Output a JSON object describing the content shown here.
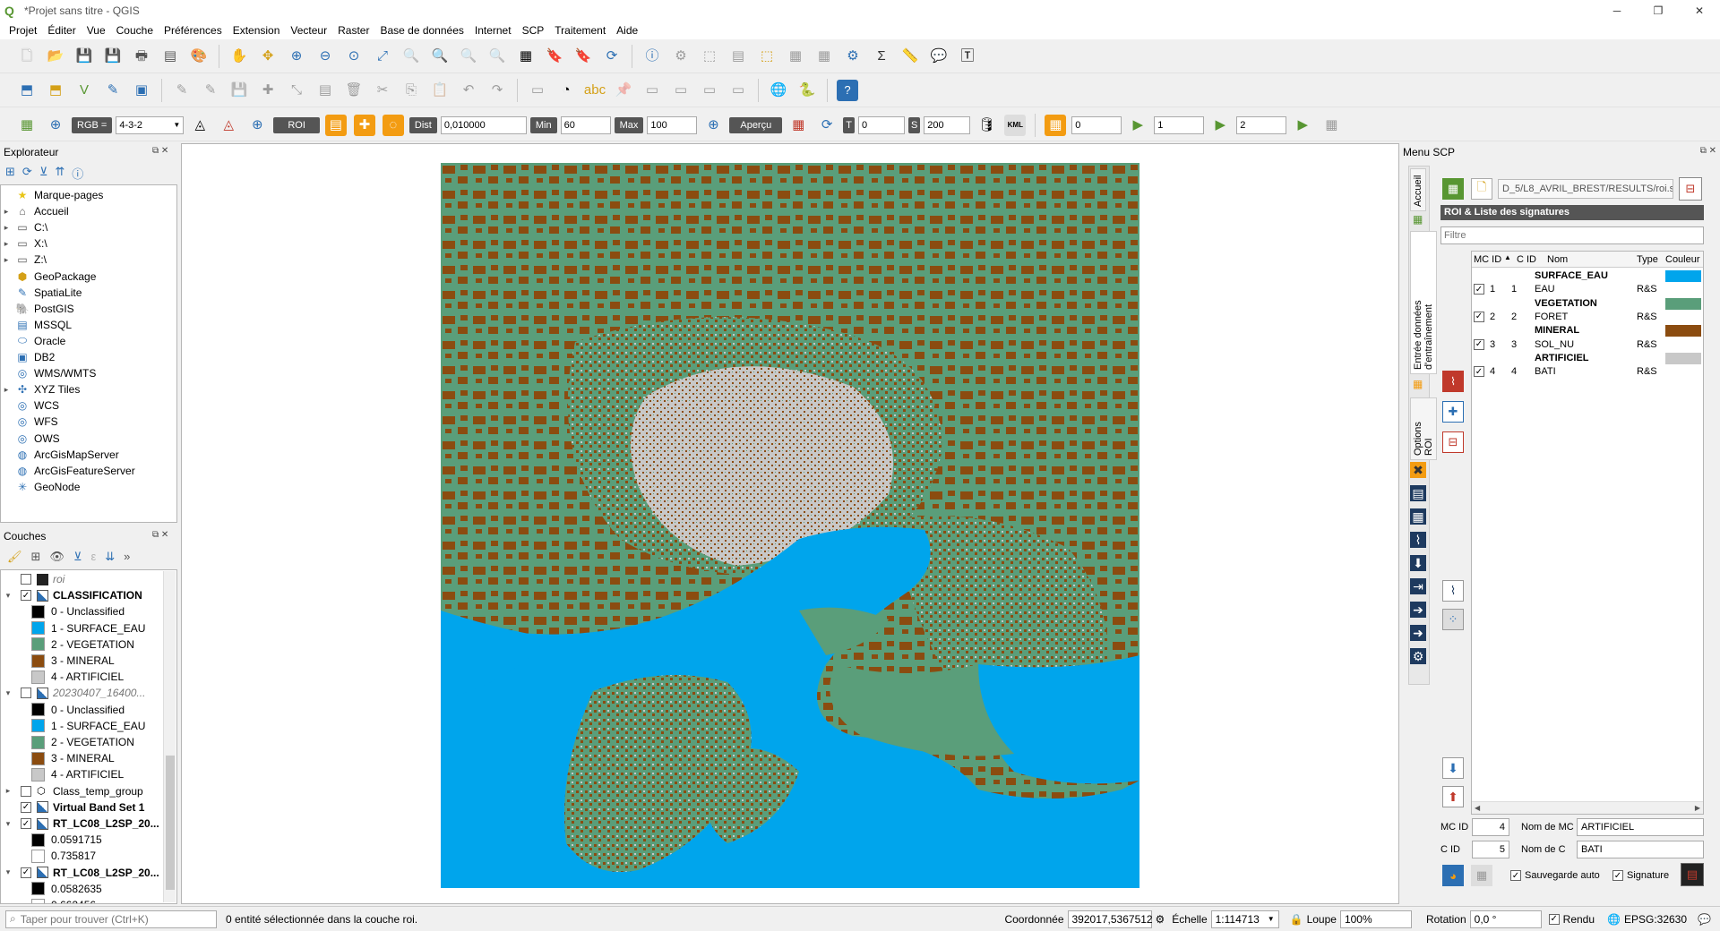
{
  "window": {
    "title": "*Projet sans titre - QGIS"
  },
  "menubar": {
    "items": [
      "Projet",
      "Éditer",
      "Vue",
      "Couche",
      "Préférences",
      "Extension",
      "Vecteur",
      "Raster",
      "Base de données",
      "Internet",
      "SCP",
      "Traitement",
      "Aide"
    ]
  },
  "scp_toolbar": {
    "rgb_label": "RGB =",
    "rgb_value": "4-3-2",
    "roi_label": "ROI",
    "dist_label": "Dist",
    "dist_value": "0,010000",
    "min_label": "Min",
    "min_value": "60",
    "max_label": "Max",
    "max_value": "100",
    "apercu_label": "Aperçu",
    "t_label": "T",
    "t_value": "0",
    "s_label": "S",
    "s_value": "200",
    "kml_label": "KML",
    "field1_value": "0",
    "field2_value": "1",
    "field3_value": "2"
  },
  "explorer": {
    "title": "Explorateur",
    "items": [
      {
        "label": "Marque-pages",
        "icon": "star-icon",
        "expandable": false
      },
      {
        "label": "Accueil",
        "icon": "folder-home-icon",
        "expandable": true
      },
      {
        "label": "C:\\",
        "icon": "folder-icon",
        "expandable": true
      },
      {
        "label": "X:\\",
        "icon": "folder-icon",
        "expandable": true
      },
      {
        "label": "Z:\\",
        "icon": "folder-icon",
        "expandable": true
      },
      {
        "label": "GeoPackage",
        "icon": "geopackage-icon",
        "expandable": false
      },
      {
        "label": "SpatiaLite",
        "icon": "spatialite-icon",
        "expandable": false
      },
      {
        "label": "PostGIS",
        "icon": "postgis-icon",
        "expandable": false
      },
      {
        "label": "MSSQL",
        "icon": "mssql-icon",
        "expandable": false
      },
      {
        "label": "Oracle",
        "icon": "oracle-icon",
        "expandable": false
      },
      {
        "label": "DB2",
        "icon": "db2-icon",
        "expandable": false
      },
      {
        "label": "WMS/WMTS",
        "icon": "wms-icon",
        "expandable": false
      },
      {
        "label": "XYZ Tiles",
        "icon": "xyz-icon",
        "expandable": true
      },
      {
        "label": "WCS",
        "icon": "wcs-icon",
        "expandable": false
      },
      {
        "label": "WFS",
        "icon": "wfs-icon",
        "expandable": false
      },
      {
        "label": "OWS",
        "icon": "ows-icon",
        "expandable": false
      },
      {
        "label": "ArcGisMapServer",
        "icon": "arcgis-icon",
        "expandable": false
      },
      {
        "label": "ArcGisFeatureServer",
        "icon": "arcgis-icon",
        "expandable": false
      },
      {
        "label": "GeoNode",
        "icon": "geonode-icon",
        "expandable": false
      }
    ]
  },
  "layers": {
    "title": "Couches",
    "items": [
      {
        "label": "roi",
        "type": "layer",
        "checked": false,
        "italic": true,
        "bold": false,
        "indent": 0,
        "icon_color": "#222222"
      },
      {
        "label": "CLASSIFICATION",
        "type": "layer",
        "checked": true,
        "italic": false,
        "bold": true,
        "indent": 0,
        "expanded": true,
        "icon_color": "raster"
      },
      {
        "label": "0 - Unclassified",
        "type": "legend",
        "color": "#000000",
        "indent": 1
      },
      {
        "label": "1 - SURFACE_EAU",
        "type": "legend",
        "color": "#00a5ec",
        "indent": 1
      },
      {
        "label": "2 - VEGETATION",
        "type": "legend",
        "color": "#5a9e7a",
        "indent": 1
      },
      {
        "label": "3 - MINERAL",
        "type": "legend",
        "color": "#8b4c10",
        "indent": 1
      },
      {
        "label": "4 - ARTIFICIEL",
        "type": "legend",
        "color": "#c8c8c8",
        "indent": 1
      },
      {
        "label": "20230407_16400...",
        "type": "layer",
        "checked": false,
        "italic": true,
        "bold": false,
        "indent": 0,
        "expanded": true,
        "icon_color": "raster"
      },
      {
        "label": "0 - Unclassified",
        "type": "legend",
        "color": "#000000",
        "indent": 1
      },
      {
        "label": "1 - SURFACE_EAU",
        "type": "legend",
        "color": "#00a5ec",
        "indent": 1
      },
      {
        "label": "2 - VEGETATION",
        "type": "legend",
        "color": "#5a9e7a",
        "indent": 1
      },
      {
        "label": "3 - MINERAL",
        "type": "legend",
        "color": "#8b4c10",
        "indent": 1
      },
      {
        "label": "4 - ARTIFICIEL",
        "type": "legend",
        "color": "#c8c8c8",
        "indent": 1
      },
      {
        "label": "Class_temp_group",
        "type": "group",
        "checked": false,
        "italic": false,
        "bold": false,
        "indent": 0
      },
      {
        "label": "Virtual Band Set 1",
        "type": "layer",
        "checked": true,
        "italic": false,
        "bold": true,
        "indent": 0,
        "icon_color": "raster"
      },
      {
        "label": "RT_LC08_L2SP_20...",
        "type": "layer",
        "checked": true,
        "italic": false,
        "bold": true,
        "indent": 0,
        "expanded": true,
        "icon_color": "raster"
      },
      {
        "label": "0.0591715",
        "type": "legend",
        "color": "#000000",
        "indent": 1
      },
      {
        "label": "0.735817",
        "type": "legend",
        "color": "#ffffff",
        "indent": 1
      },
      {
        "label": "RT_LC08_L2SP_20...",
        "type": "layer",
        "checked": true,
        "italic": false,
        "bold": true,
        "indent": 0,
        "expanded": true,
        "icon_color": "raster"
      },
      {
        "label": "0.0582635",
        "type": "legend",
        "color": "#000000",
        "indent": 1
      },
      {
        "label": "0.662456",
        "type": "legend",
        "color": "#ffffff",
        "indent": 1
      }
    ]
  },
  "scp_menu": {
    "title": "Menu SCP",
    "tabs": [
      "Accueil",
      "Entrée données d'entraînement",
      "Options ROI"
    ],
    "file_path": "D_5/L8_AVRIL_BREST/RESULTS/roi.scp",
    "section_title": "ROI & Liste des signatures",
    "filter_placeholder": "Filtre",
    "columns": [
      "MC ID",
      "C ID",
      "Nom",
      "Type",
      "Couleur"
    ],
    "rows": [
      {
        "mc_id": "",
        "c_id": "",
        "name": "SURFACE_EAU",
        "type": "",
        "color": "#00a5ec",
        "is_class": true,
        "checked": false
      },
      {
        "mc_id": "1",
        "c_id": "1",
        "name": "EAU",
        "type": "R&S",
        "color": "",
        "is_class": false,
        "checked": true
      },
      {
        "mc_id": "",
        "c_id": "",
        "name": "VEGETATION",
        "type": "",
        "color": "#5a9e7a",
        "is_class": true,
        "checked": false
      },
      {
        "mc_id": "2",
        "c_id": "2",
        "name": "FORET",
        "type": "R&S",
        "color": "",
        "is_class": false,
        "checked": true
      },
      {
        "mc_id": "",
        "c_id": "",
        "name": "MINERAL",
        "type": "",
        "color": "#8b4c10",
        "is_class": true,
        "checked": false
      },
      {
        "mc_id": "3",
        "c_id": "3",
        "name": "SOL_NU",
        "type": "R&S",
        "color": "",
        "is_class": false,
        "checked": true
      },
      {
        "mc_id": "",
        "c_id": "",
        "name": "ARTIFICIEL",
        "type": "",
        "color": "#c8c8c8",
        "is_class": true,
        "checked": false
      },
      {
        "mc_id": "4",
        "c_id": "4",
        "name": "BATI",
        "type": "R&S",
        "color": "",
        "is_class": false,
        "checked": true
      }
    ],
    "mc_id_label": "MC ID",
    "mc_id_value": "4",
    "mc_name_label": "Nom de MC",
    "mc_name_value": "ARTIFICIEL",
    "c_id_label": "C ID",
    "c_id_value": "5",
    "c_name_label": "Nom de C",
    "c_name_value": "BATI",
    "autosave_label": "Sauvegarde auto",
    "signature_label": "Signature"
  },
  "statusbar": {
    "search_placeholder": "Taper pour trouver (Ctrl+K)",
    "message": "0 entité sélectionnée dans la couche roi.",
    "coord_label": "Coordonnée",
    "coord_value": "392017,5367512",
    "scale_label": "Échelle",
    "scale_value": "1:114713",
    "magnifier_label": "Loupe",
    "magnifier_value": "100%",
    "rotation_label": "Rotation",
    "rotation_value": "0,0 °",
    "render_label": "Rendu",
    "crs_label": "EPSG:32630"
  },
  "colors": {
    "water": "#00a5ec",
    "vegetation": "#5a9e7a",
    "mineral": "#8b4c10",
    "artificial": "#c8c8c8"
  }
}
